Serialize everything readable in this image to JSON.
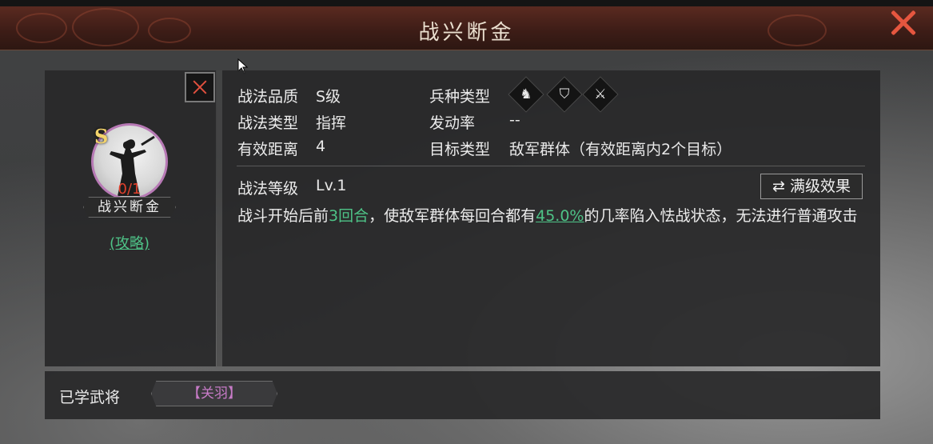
{
  "window": {
    "title": "战兴断金"
  },
  "skill_card": {
    "grade": "S",
    "progress": "0/1",
    "name": "战兴断金",
    "guide_link": "(攻略)"
  },
  "info": {
    "quality_label": "战法品质",
    "quality_value": "S级",
    "skill_type_label": "战法类型",
    "skill_type_value": "指挥",
    "range_label": "有效距离",
    "range_value": "4",
    "troop_type_label": "兵种类型",
    "troop_icons": [
      {
        "name": "cavalry-icon",
        "glyph": "♞"
      },
      {
        "name": "shield-icon",
        "glyph": "⛉"
      },
      {
        "name": "bow-icon",
        "glyph": "⚔"
      }
    ],
    "trigger_rate_label": "发动率",
    "trigger_rate_value": "--",
    "target_type_label": "目标类型",
    "target_type_value": "敌军群体（有效距离内2个目标）"
  },
  "level": {
    "label": "战法等级",
    "value": "Lv.1",
    "max_button": "满级效果",
    "max_button_icon": "⇄"
  },
  "description": {
    "part1": "战斗开始后前",
    "rounds": "3回合",
    "part2": "，使敌军群体每回合都有",
    "rate": "45.0%",
    "part3": "的几率陷入怯战状态，无法进行普通攻击"
  },
  "learned": {
    "label": "已学武将",
    "hero": "【关羽】"
  },
  "colors": {
    "highlight": "#4ec387",
    "close_red": "#e5563f",
    "hero_purple": "#c77bc7",
    "grade_gold": "#f3d36b"
  }
}
